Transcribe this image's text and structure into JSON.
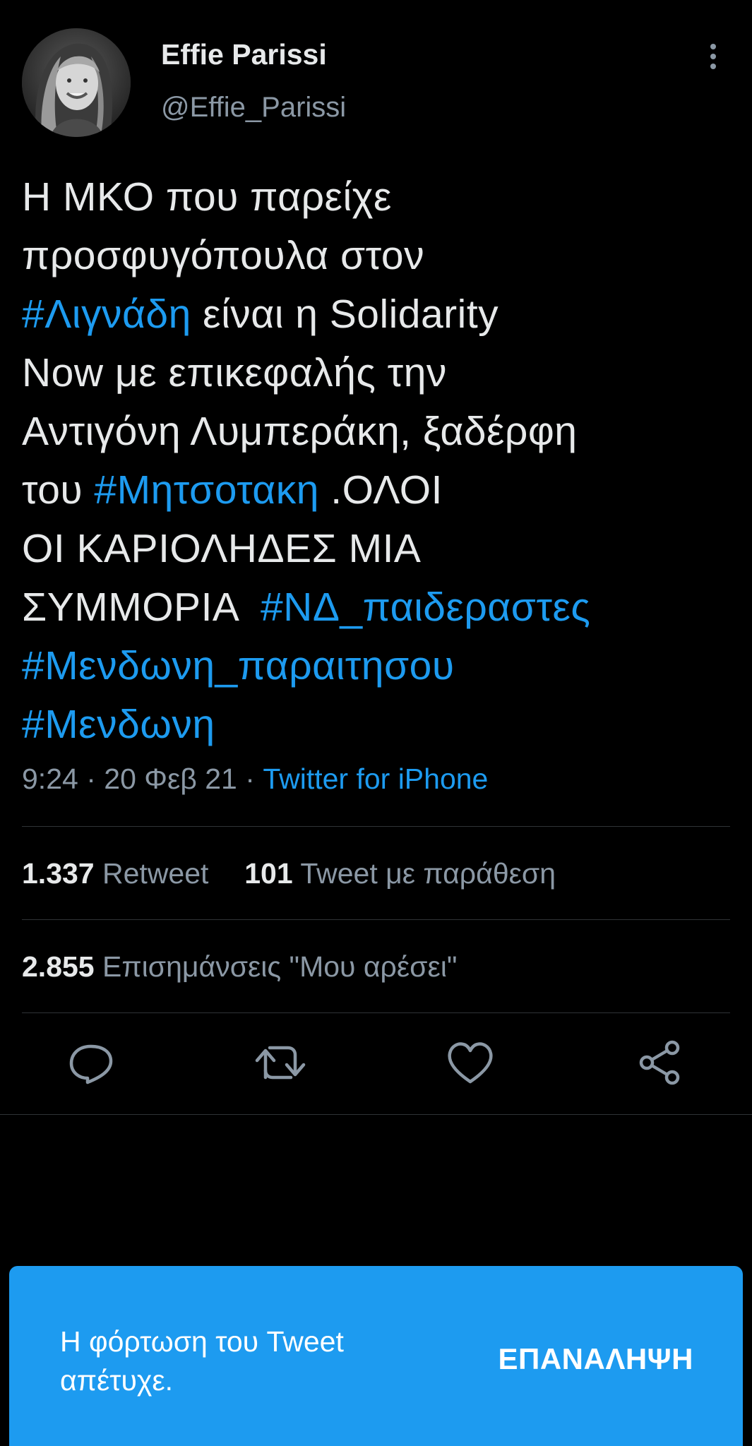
{
  "author": {
    "display_name": "Effie Parissi",
    "handle": "@Effie_Parissi"
  },
  "tweet": {
    "lines": [
      [
        {
          "t": "Η ΜΚΟ που παρείχε",
          "tag": false
        }
      ],
      [
        {
          "t": "προσφυγόπουλα στον",
          "tag": false
        }
      ],
      [
        {
          "t": "#Λιγνάδη",
          "tag": true
        },
        {
          "t": " είναι η Solidarity",
          "tag": false
        }
      ],
      [
        {
          "t": "Now με επικεφαλής την",
          "tag": false
        }
      ],
      [
        {
          "t": "Αντιγόνη Λυμπεράκη, ξαδέρφη",
          "tag": false
        }
      ],
      [
        {
          "t": "του ",
          "tag": false
        },
        {
          "t": "#Μητσοτακη",
          "tag": true
        },
        {
          "t": " .ΟΛΟΙ",
          "tag": false
        }
      ],
      [
        {
          "t": "ΟΙ ΚΑΡΙΟΛΗΔΕΣ ΜΙΑ",
          "tag": false
        }
      ],
      [
        {
          "t": "ΣΥΜΜΟΡΙΑ  ",
          "tag": false
        },
        {
          "t": "#ΝΔ_παιδεραστες",
          "tag": true
        }
      ],
      [
        {
          "t": "#Μενδωνη_παραιτησου",
          "tag": true
        }
      ],
      [
        {
          "t": "#Μενδωνη",
          "tag": true
        }
      ]
    ],
    "time": "9:24",
    "date": "20 Φεβ 21",
    "separator": "·",
    "source": "Twitter for iPhone"
  },
  "stats": {
    "retweets_count": "1.337",
    "retweets_label": "Retweet",
    "quotes_count": "101",
    "quotes_label": "Tweet με παράθεση",
    "likes_count": "2.855",
    "likes_label": "Επισημάνσεις \"Μου αρέσει\""
  },
  "actions": {
    "icons": [
      "reply-icon",
      "retweet-icon",
      "like-icon",
      "share-icon"
    ]
  },
  "toast": {
    "message_line1": "Η φόρτωση του Tweet",
    "message_line2": "απέτυχε.",
    "retry_label": "ΕΠΑΝΑΛΗΨΗ"
  },
  "colors": {
    "background": "#000000",
    "text": "#e7e9ea",
    "secondary": "#8b98a5",
    "accent": "#1d9bf0",
    "divider": "#2f3336"
  }
}
